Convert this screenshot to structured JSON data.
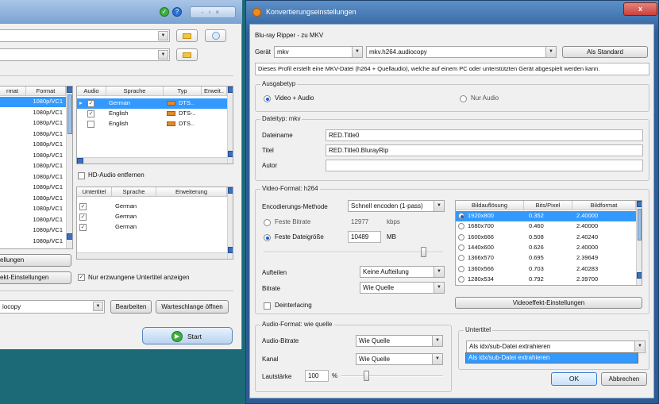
{
  "colors": {
    "desktop": "#1c6a78",
    "accent": "#3399ff",
    "title_close": "#c9403a"
  },
  "bg_window": {
    "table1_headers": [
      "rmat",
      "Format"
    ],
    "table1_rows": [
      [
        "",
        "1080p/VC1"
      ],
      [
        "",
        "1080p/VC1"
      ],
      [
        "",
        "1080p/VC1"
      ],
      [
        "",
        "1080p/VC1"
      ],
      [
        "",
        "1080p/VC1"
      ],
      [
        "",
        "1080p/VC1"
      ],
      [
        "",
        "1080p/VC1"
      ],
      [
        "",
        "1080p/VC1"
      ],
      [
        "",
        "1080p/VC1"
      ],
      [
        "",
        "1080p/VC1"
      ],
      [
        "",
        "1080p/VC1"
      ],
      [
        "",
        "1080p/VC1"
      ],
      [
        "",
        "1080p/VC1"
      ],
      [
        "",
        "1080p/VC1"
      ]
    ],
    "audio_headers": [
      "Audio",
      "Sprache",
      "Typ",
      "Erweit.."
    ],
    "audio_rows": [
      {
        "lang": "German",
        "typ": "DTS..",
        "checked": true
      },
      {
        "lang": "English",
        "typ": "DTS-..",
        "checked": true
      },
      {
        "lang": "English",
        "typ": "DTS..",
        "checked": false
      }
    ],
    "hd_audio_label": "HD-Audio entfernen",
    "sub_headers": [
      "Untertitel",
      "Sprache",
      "Erweiterung"
    ],
    "sub_rows": [
      "German",
      "German",
      "German"
    ],
    "btn_settings": "ellungen",
    "btn_effects": "ekt-Einstellungen",
    "forced_subs_label": "Nur erzwungene Untertitel anzeigen",
    "profile_value": "iocopy",
    "btn_edit": "Bearbeiten",
    "btn_queue": "Warteschlange öffnen",
    "btn_start": "Start"
  },
  "dialog": {
    "title": "Konvertierungseinstellungen",
    "breadcrumb": "Blu-ray Ripper - zu MKV",
    "device_label": "Gerät",
    "device_value": "mkv",
    "profile_value": "mkv.h264.audiocopy",
    "default_button": "Als Standard",
    "description": "Dieses Profil erstellt eine MKV-Datei (h264 + Quellaudio), welche auf einem PC oder unterstützten Gerät abgespielt werden kann.",
    "output_group": "Ausgabetyp",
    "opt_video_audio": "Video + Audio",
    "opt_audio_only": "Nur Audio",
    "file_group": "Dateityp: mkv",
    "filename_label": "Dateiname",
    "filename_value": "RED.Title0",
    "title_label": "Titel",
    "title_value": "RED.Title0.BlurayRip",
    "author_label": "Autor",
    "author_value": "",
    "video_group": "Video-Format: h264",
    "enc_label": "Encodierungs-Methode",
    "enc_value": "Schnell encoden (1-pass)",
    "fixed_bitrate_label": "Feste Bitrate",
    "fixed_bitrate_value": "12977",
    "fixed_bitrate_unit": "kbps",
    "fixed_size_label": "Feste Dateigröße",
    "fixed_size_value": "10489",
    "fixed_size_unit": "MB",
    "split_label": "Aufteilen",
    "split_value": "Keine Aufteilung",
    "bitrate_label": "Bitrate",
    "bitrate_value": "Wie Quelle",
    "deinterlace_label": "Deinterlacing",
    "res_headers": [
      "Bildauflösung",
      "Bits/Pixel",
      "Bildformat"
    ],
    "res_rows": [
      [
        "1920x800",
        "0.352",
        "2.40000"
      ],
      [
        "1680x700",
        "0.460",
        "2.40000"
      ],
      [
        "1600x666",
        "0.508",
        "2.40240"
      ],
      [
        "1440x600",
        "0.626",
        "2.40000"
      ],
      [
        "1366x570",
        "0.695",
        "2.39649"
      ],
      [
        "1360x566",
        "0.703",
        "2.40283"
      ],
      [
        "1280x534",
        "0.792",
        "2.39700"
      ]
    ],
    "video_effects_button": "Videoeffekt-Einstellungen",
    "audio_group": "Audio-Format: wie quelle",
    "audio_bitrate_label": "Audio-Bitrate",
    "audio_bitrate_value": "Wie Quelle",
    "channel_label": "Kanal",
    "channel_value": "Wie Quelle",
    "volume_label": "Lautstärke",
    "volume_value": "100",
    "volume_unit": "%",
    "subtitle_group": "Untertitel",
    "subtitle_value": "Als idx/sub-Datei extrahieren",
    "subtitle_dropdown_option": "Als idx/sub-Datei extrahieren",
    "ok_button": "OK",
    "cancel_button": "Abbrechen"
  }
}
